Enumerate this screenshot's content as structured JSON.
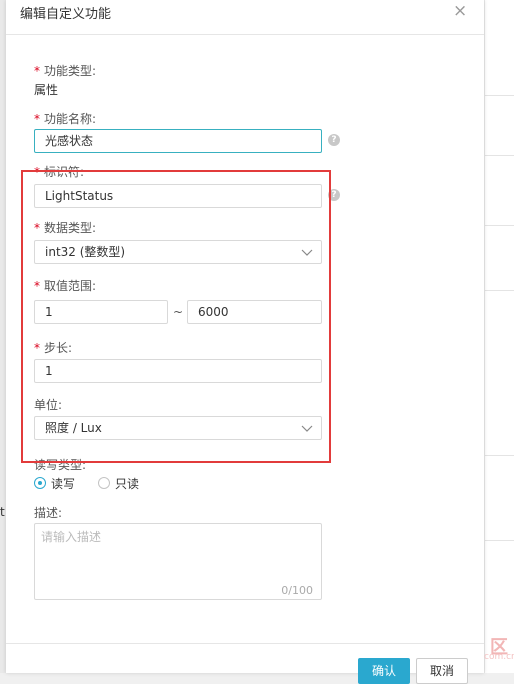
{
  "dialog": {
    "title": "编辑自定义功能",
    "close_symbol": "×"
  },
  "form": {
    "type_label": "功能类型:",
    "type_value": "属性",
    "name_label": "功能名称:",
    "name_value": "光感状态",
    "identifier_label": "标识符:",
    "identifier_value": "LightStatus",
    "datatype_label": "数据类型:",
    "datatype_value": "int32 (整数型)",
    "range_label": "取值范围:",
    "range_min": "1",
    "range_sep": "~",
    "range_max": "6000",
    "step_label": "步长:",
    "step_value": "1",
    "unit_label": "单位:",
    "unit_value": "照度 / Lux",
    "rw_label": "读写类型:",
    "rw_options": [
      "读写",
      "只读"
    ],
    "rw_selected": "读写",
    "desc_label": "描述:",
    "desc_placeholder": "请输入描述",
    "desc_counter": "0/100",
    "required_mark": "*",
    "help_symbol": "?"
  },
  "footer": {
    "confirm_label": "确认",
    "cancel_label": "取消"
  },
  "background": {
    "partial_text": "t",
    "watermark": "区",
    "watermark_small": "com.cn"
  },
  "colors": {
    "accent": "#2aa8cf",
    "required": "#d9001b",
    "highlight_box": "#e23b3b"
  },
  "icons": {
    "close": "close-icon",
    "help": "help-circle-icon",
    "dropdown": "chevron-down-icon"
  }
}
